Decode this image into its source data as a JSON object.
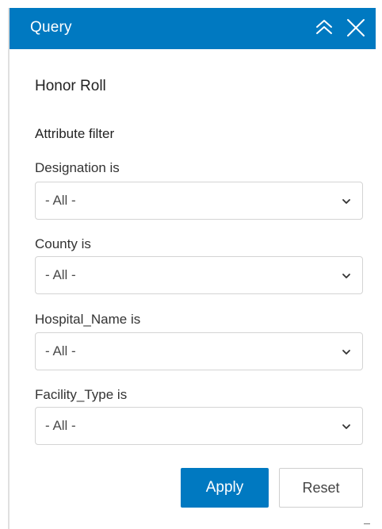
{
  "header": {
    "title": "Query",
    "collapse_icon": "double-chevron-up-icon",
    "close_icon": "close-icon"
  },
  "query": {
    "title": "Honor Roll",
    "section_label": "Attribute filter"
  },
  "filters": [
    {
      "label": "Designation is",
      "value": "- All -"
    },
    {
      "label": "County is",
      "value": "- All -"
    },
    {
      "label": "Hospital_Name is",
      "value": "- All -"
    },
    {
      "label": "Facility_Type is",
      "value": "- All -"
    }
  ],
  "actions": {
    "apply_label": "Apply",
    "reset_label": "Reset"
  },
  "colors": {
    "accent": "#0079c1",
    "border": "#d4d4d4",
    "text": "#222222"
  }
}
